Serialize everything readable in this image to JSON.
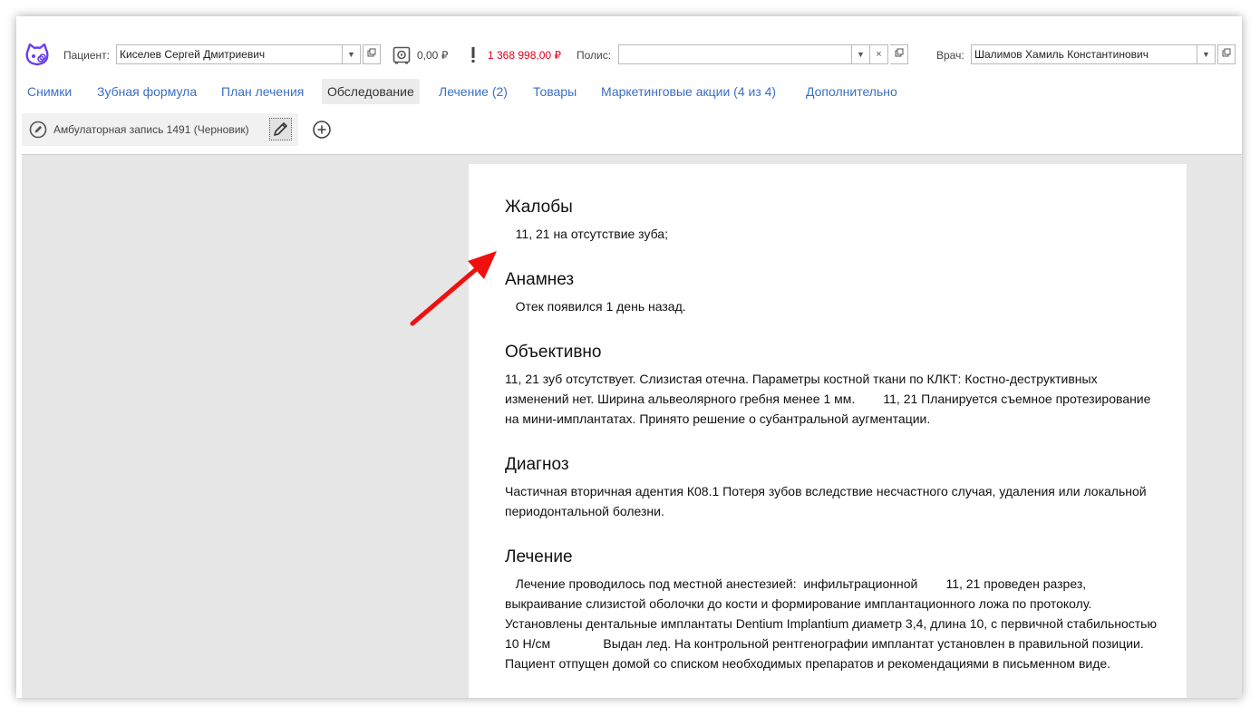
{
  "header": {
    "patient_label": "Пациент:",
    "patient_value": "Киселев Сергей Дмитриевич",
    "balance": "0,00 ₽",
    "debt": "1 368 998,00 ₽",
    "policy_label": "Полис:",
    "policy_value": "",
    "doctor_label": "Врач:",
    "doctor_value": "Шалимов Хамиль Константинович"
  },
  "tabs": [
    {
      "label": "Снимки"
    },
    {
      "label": "Зубная формула"
    },
    {
      "label": "План лечения"
    },
    {
      "label": "Обследование",
      "active": true
    },
    {
      "label": "Лечение (2)"
    },
    {
      "label": "Товары"
    },
    {
      "label": "Маркетинговые акции (4 из 4)"
    },
    {
      "label": "Дополнительно"
    }
  ],
  "toolbar": {
    "record_label": "Амбулаторная запись 1491 (Черновик)"
  },
  "document": {
    "sections": [
      {
        "heading": "Жалобы",
        "text": "   11, 21 на отсутствие зуба;"
      },
      {
        "heading": "Анамнез",
        "text": "   Отек появился 1 день назад."
      },
      {
        "heading": "Объективно",
        "text": "11, 21 зуб отсутствует. Слизистая отечна. Параметры костной ткани по КЛКТ: Костно-деструктивных изменений нет. Ширина альвеолярного гребня менее 1 мм.        11, 21 Планируется съемное протезирование на мини-имплантатах. Принято решение о субантральной аугментации."
      },
      {
        "heading": "Диагноз",
        "text": "Частичная вторичная адентия К08.1 Потеря зубов вследствие несчастного случая, удаления или локальной периодонтальной болезни."
      },
      {
        "heading": "Лечение",
        "text": "   Лечение проводилось под местной анестезией:  инфильтрационной        11, 21 проведен разрез, выкраивание слизистой оболочки до кости и формирование имплантационного ложа по протоколу. Установлены дентальные имплантаты Dentium Implantium диаметр 3,4, длина 10, с первичной стабильностью 10 Н/см               Выдан лед. На контрольной рентгенографии имплантат установлен в правильной позиции. Пациент отпущен домой со списком необходимых препаратов и рекомендациями в письменном виде."
      }
    ]
  },
  "colors": {
    "link": "#3a6fc4",
    "debt": "#e0001b",
    "logo": "#6a3df0",
    "arrow": "#f01010"
  },
  "icons": {
    "logo": "cat-logo-icon",
    "safe": "safe-icon",
    "warning": "exclamation-icon",
    "edit": "pencil-icon",
    "add": "plus-circle-icon"
  }
}
